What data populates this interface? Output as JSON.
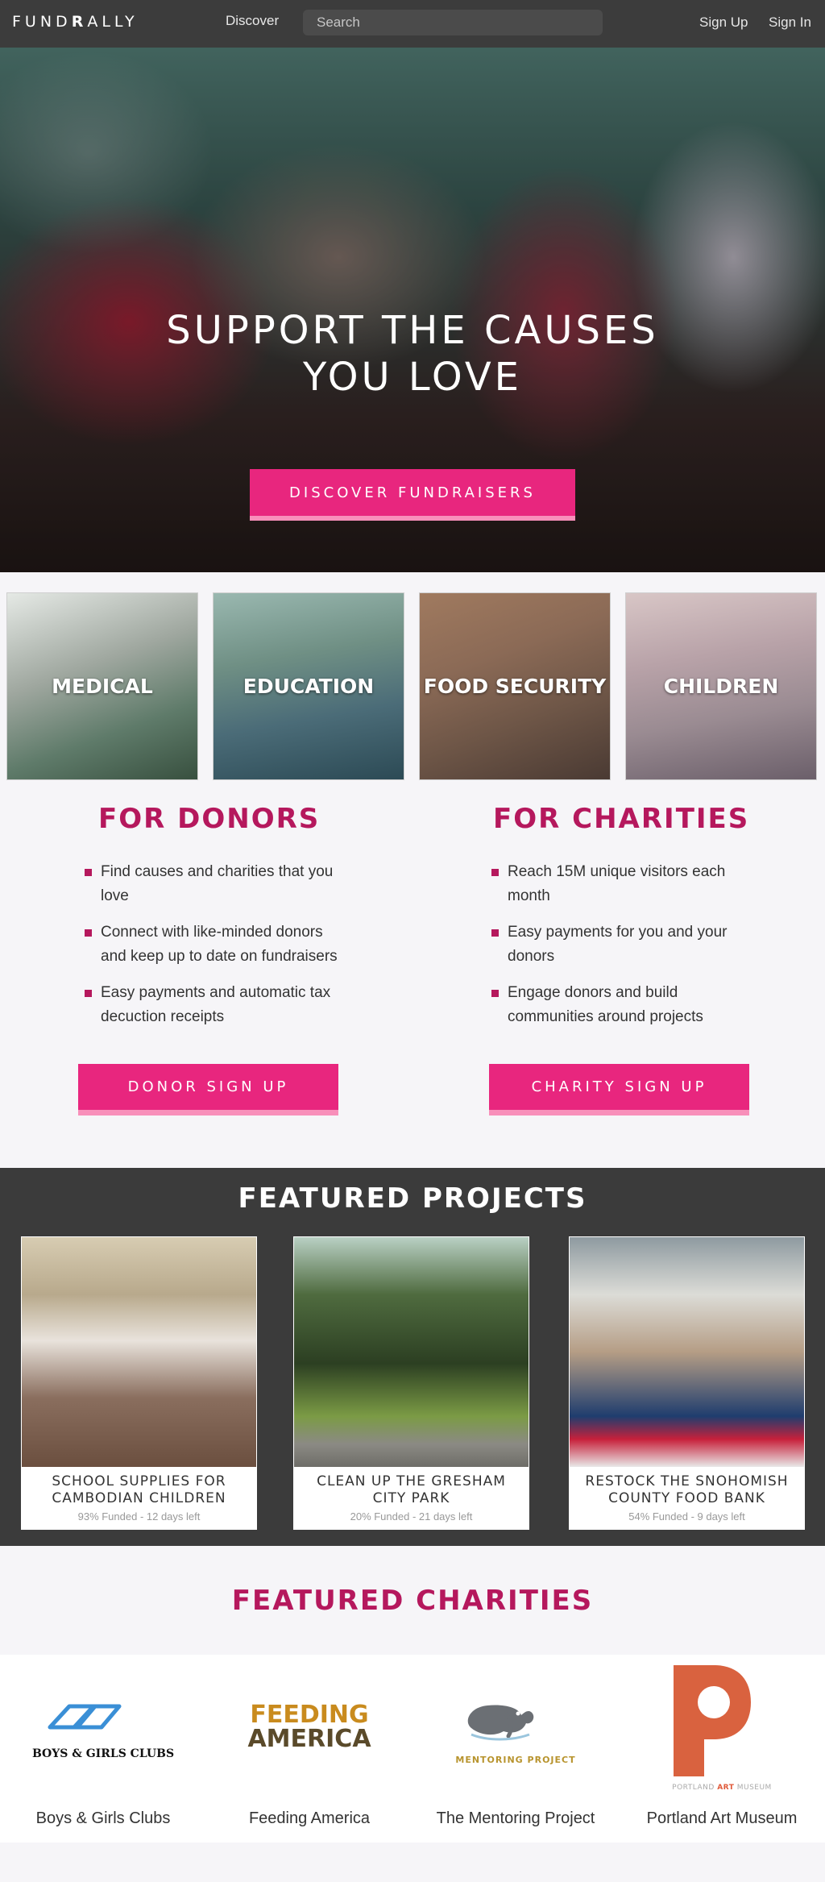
{
  "nav": {
    "logo": "FUNDRALLY",
    "discover": "Discover",
    "search_placeholder": "Search",
    "sign_up": "Sign Up",
    "sign_in": "Sign In"
  },
  "hero": {
    "title": "SUPPORT THE CAUSES\nYOU LOVE",
    "button": "DISCOVER FUNDRAISERS"
  },
  "categories": [
    "MEDICAL",
    "EDUCATION",
    "FOOD SECURITY",
    "CHILDREN"
  ],
  "donors": {
    "title": "FOR DONORS",
    "bullets": [
      "Find causes and charities that you love",
      "Connect with like-minded donors and keep up to date on fundraisers",
      "Easy payments and automatic tax decuction receipts"
    ],
    "button": "DONOR SIGN UP"
  },
  "charities_info": {
    "title": "FOR CHARITIES",
    "bullets": [
      "Reach 15M unique visitors each month",
      "Easy payments for you and your donors",
      "Engage donors and build communities around projects"
    ],
    "button": "CHARITY SIGN UP"
  },
  "projects": {
    "title": "FEATURED PROJECTS",
    "items": [
      {
        "name": "SCHOOL SUPPLIES FOR CAMBODIAN CHILDREN",
        "meta": "93% Funded - 12 days left"
      },
      {
        "name": "CLEAN UP THE GRESHAM CITY PARK",
        "meta": "20% Funded - 21 days left"
      },
      {
        "name": "RESTOCK THE SNOHOMISH COUNTY FOOD BANK",
        "meta": "54% Funded - 9 days left"
      }
    ]
  },
  "featured_charities": {
    "title": "FEATURED CHARITIES",
    "items": [
      {
        "name": "Boys & Girls Clubs",
        "logo_text": "BOYS & GIRLS CLUBS"
      },
      {
        "name": "Feeding America",
        "logo_text_1": "FEEDING",
        "logo_text_2": "AMERICA"
      },
      {
        "name": "The Mentoring Project",
        "logo_text": "MENTORING PROJECT"
      },
      {
        "name": "Portland Art Museum",
        "logo_text_1": "PORTLAND",
        "logo_text_2": "ART",
        "logo_text_3": "MUSEUM"
      }
    ]
  },
  "colors": {
    "brand_magenta": "#b5185d",
    "button_pink": "#e8267e",
    "nav_bg": "#3c3c3c"
  }
}
